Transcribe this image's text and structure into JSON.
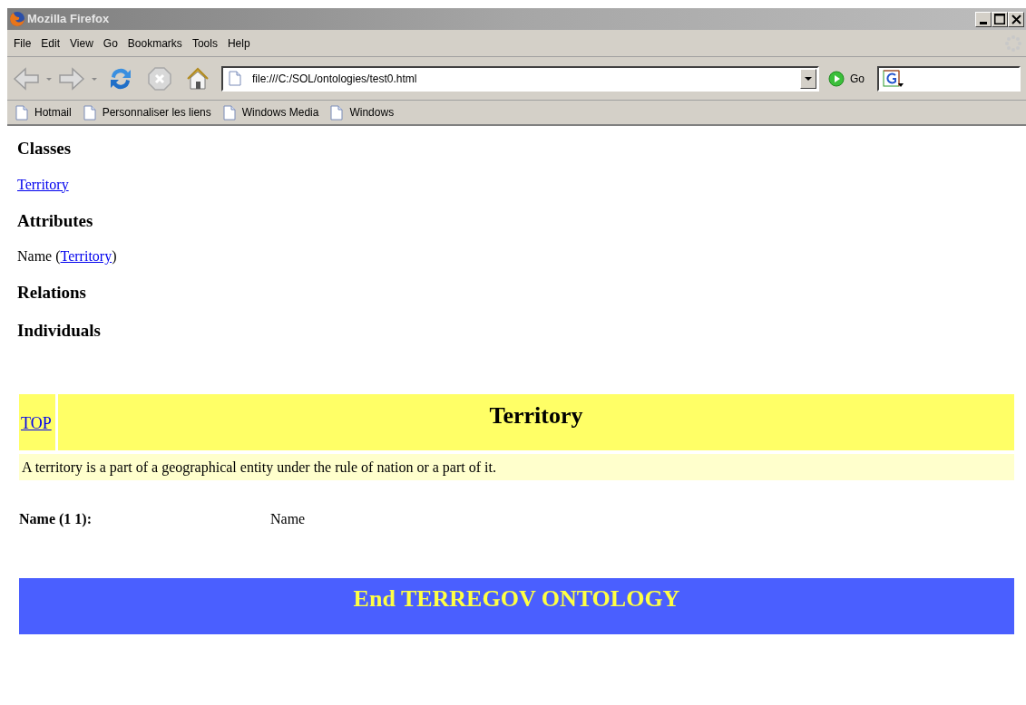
{
  "window": {
    "title": "Mozilla Firefox"
  },
  "menu": [
    "File",
    "Edit",
    "View",
    "Go",
    "Bookmarks",
    "Tools",
    "Help"
  ],
  "toolbar": {
    "url": "file:///C:/SOL/ontologies/test0.html",
    "go": "Go"
  },
  "bookmarks": [
    "Hotmail",
    "Personnaliser les liens",
    "Windows Media",
    "Windows"
  ],
  "content": {
    "sections": [
      {
        "heading": "Classes",
        "line": [
          {
            "text": "Territory",
            "link": true
          }
        ]
      },
      {
        "heading": "Attributes",
        "line": [
          {
            "text": "Name (",
            "link": false
          },
          {
            "text": "Territory",
            "link": true
          },
          {
            "text": ")",
            "link": false
          }
        ]
      },
      {
        "heading": "Relations"
      },
      {
        "heading": "Individuals"
      }
    ],
    "class_table": {
      "top_link": "TOP",
      "title": "Territory",
      "description": "A territory is a part of a geographical entity under the rule of nation or a part of it."
    },
    "attributes": [
      {
        "label": "Name (1 1):",
        "value": "Name"
      }
    ],
    "footer": "End TERREGOV ONTOLOGY"
  }
}
